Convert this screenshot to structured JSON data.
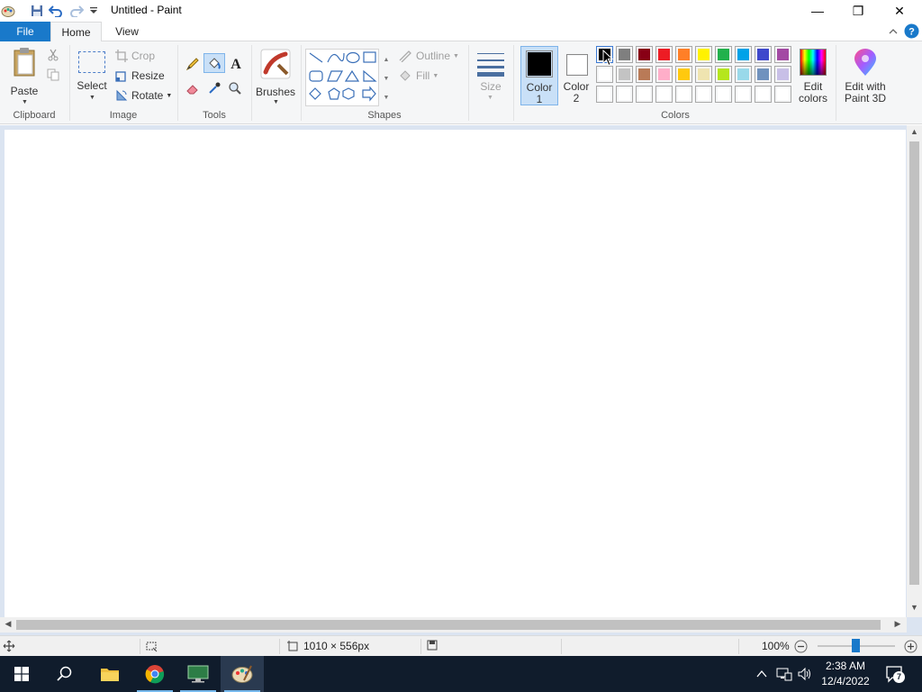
{
  "window": {
    "title": "Untitled - Paint",
    "minimize_glyph": "—",
    "maximize_glyph": "❐",
    "close_glyph": "✕"
  },
  "tabs": {
    "file": "File",
    "home": "Home",
    "view": "View"
  },
  "ribbon": {
    "clipboard": {
      "group_label": "Clipboard",
      "paste": "Paste"
    },
    "image": {
      "group_label": "Image",
      "select": "Select",
      "crop": "Crop",
      "resize": "Resize",
      "rotate": "Rotate"
    },
    "tools": {
      "group_label": "Tools"
    },
    "brushes": {
      "label": "Brushes"
    },
    "shapes": {
      "group_label": "Shapes",
      "outline": "Outline",
      "fill": "Fill"
    },
    "size": {
      "label": "Size"
    },
    "colors": {
      "group_label": "Colors",
      "color1_line1": "Color",
      "color1_line2": "1",
      "color2_line1": "Color",
      "color2_line2": "2",
      "color1_value": "#000000",
      "color2_value": "#ffffff",
      "edit_colors_line1": "Edit",
      "edit_colors_line2": "colors",
      "palette": [
        [
          "#000000",
          "#7f7f7f",
          "#880015",
          "#ed1c24",
          "#ff7f27",
          "#fff200",
          "#22b14c",
          "#00a2e8",
          "#3f48cc",
          "#a349a4"
        ],
        [
          "#ffffff",
          "#c3c3c3",
          "#b97a57",
          "#ffaec9",
          "#ffc90e",
          "#efe4b0",
          "#b5e61d",
          "#99d9ea",
          "#7092be",
          "#c8bfe7"
        ],
        [
          "#ffffff",
          "#ffffff",
          "#ffffff",
          "#ffffff",
          "#ffffff",
          "#ffffff",
          "#ffffff",
          "#ffffff",
          "#ffffff",
          "#ffffff"
        ]
      ]
    },
    "paint3d": {
      "line1": "Edit with",
      "line2": "Paint 3D"
    }
  },
  "status": {
    "dimensions": "1010 × 556px",
    "zoom": "100%"
  },
  "taskbar": {
    "time": "2:38 AM",
    "date": "12/4/2022",
    "notification_count": "7"
  },
  "accent": "#1979ca"
}
